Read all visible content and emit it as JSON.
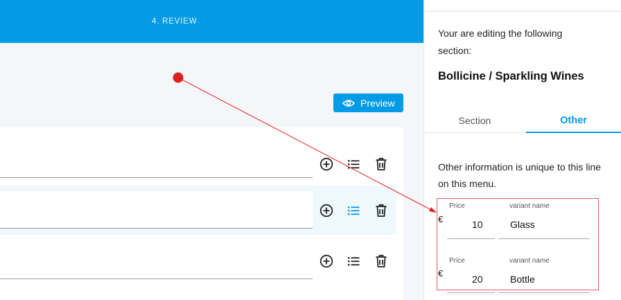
{
  "header": {
    "step_label": "4. REVIEW"
  },
  "toolbar": {
    "preview_label": "Preview"
  },
  "rows": [
    {
      "selected": false
    },
    {
      "selected": true
    },
    {
      "selected": false
    }
  ],
  "panel": {
    "editing_intro": "Your are editing the following section:",
    "section_name": "Bollicine / Sparkling Wines",
    "tabs": [
      {
        "label": "Section",
        "active": false
      },
      {
        "label": "Other",
        "active": true
      }
    ],
    "other_info": "Other information is unique to this line on this menu.",
    "variants": [
      {
        "price_label": "Price",
        "currency": "€",
        "price": "10",
        "name_label": "variant name",
        "name": "Glass"
      },
      {
        "price_label": "Price",
        "currency": "€",
        "price": "20",
        "name_label": "variant name",
        "name": "Bottle"
      }
    ]
  },
  "colors": {
    "accent": "#039be5",
    "annotation": "#e02020",
    "highlight_box": "#e05a66"
  }
}
